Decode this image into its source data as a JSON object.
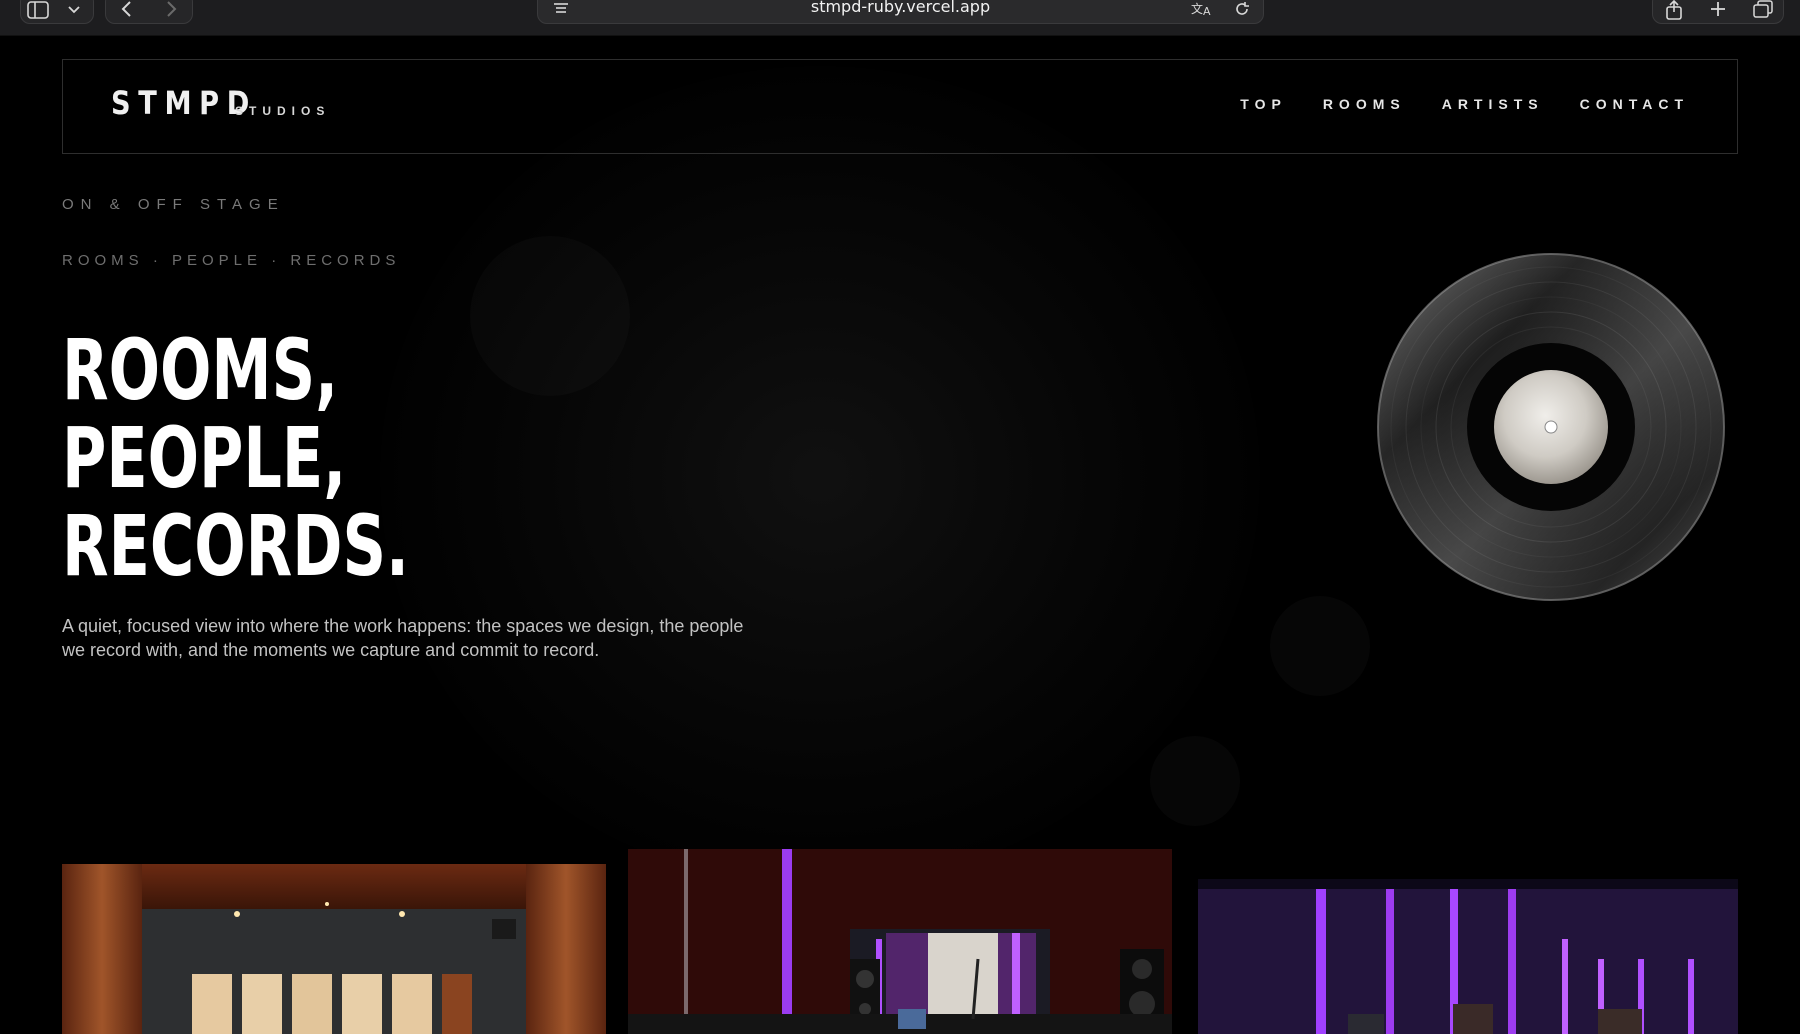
{
  "browser": {
    "url": "stmpd-ruby.vercel.app"
  },
  "nav": {
    "logo": "STMPD",
    "logo_sub": "STUDIOS",
    "links": [
      "TOP",
      "ROOMS",
      "ARTISTS",
      "CONTACT"
    ]
  },
  "hero": {
    "kicker": "ON & OFF STAGE",
    "tagline": "ROOMS · PEOPLE · RECORDS",
    "headline": [
      "ROOMS,",
      "PEOPLE,",
      "RECORDS."
    ],
    "description": "A quiet, focused view into where the work happens: the spaces we design, the people we record with, and the moments we capture and commit to record."
  },
  "gallery": {
    "images": [
      "studio-room-wood-panels",
      "studio-control-room-purple",
      "studio-live-room-purple"
    ]
  },
  "colors": {
    "background": "#000000",
    "accent_purple": "#8a2be2",
    "wood": "#7a3b1c"
  }
}
